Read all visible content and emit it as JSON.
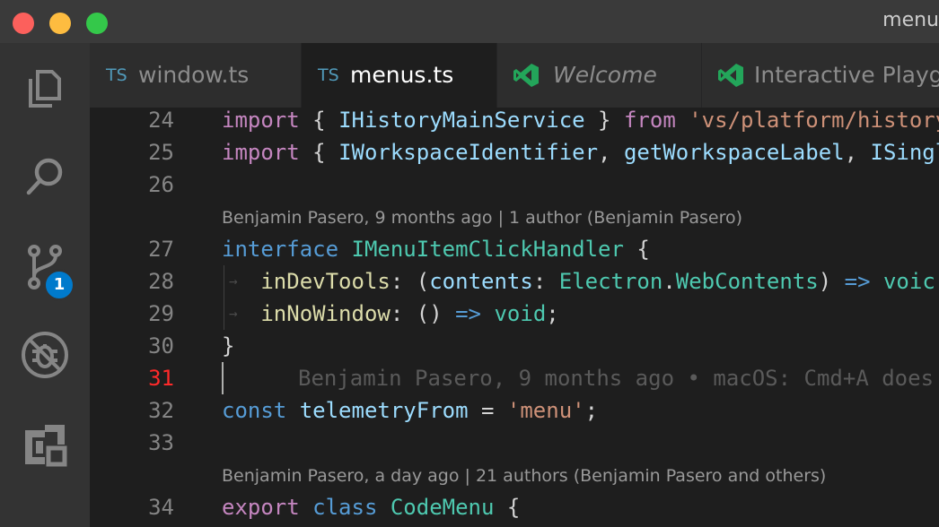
{
  "window": {
    "title": "menu"
  },
  "activity_bar": {
    "items": [
      {
        "name": "explorer",
        "icon": "files-icon"
      },
      {
        "name": "search",
        "icon": "search-icon"
      },
      {
        "name": "source-control",
        "icon": "source-control-icon",
        "badge": "1"
      },
      {
        "name": "debug",
        "icon": "debug-icon"
      },
      {
        "name": "extensions",
        "icon": "extensions-icon"
      }
    ]
  },
  "tabs": [
    {
      "label": "window.ts",
      "icon_text": "TS",
      "active": false
    },
    {
      "label": "menus.ts",
      "icon_text": "TS",
      "active": true
    },
    {
      "label": "Welcome",
      "icon": "vscode-icon",
      "italic": true
    },
    {
      "label": "Interactive Playg",
      "icon": "vscode-icon"
    }
  ],
  "editor": {
    "lines": [
      {
        "num": "24",
        "parts": [
          [
            "kw",
            "import"
          ],
          [
            "p",
            " { "
          ],
          [
            "var",
            "IHistoryMainService"
          ],
          [
            "p",
            " } "
          ],
          [
            "kw",
            "from"
          ],
          [
            "p",
            " "
          ],
          [
            "str",
            "'vs/platform/history"
          ]
        ]
      },
      {
        "num": "25",
        "parts": [
          [
            "kw",
            "import"
          ],
          [
            "p",
            " { "
          ],
          [
            "var",
            "IWorkspaceIdentifier"
          ],
          [
            "p",
            ", "
          ],
          [
            "var",
            "getWorkspaceLabel"
          ],
          [
            "p",
            ", "
          ],
          [
            "var",
            "ISingl"
          ]
        ]
      },
      {
        "num": "26",
        "parts": []
      },
      {
        "num": "27",
        "parts": [
          [
            "kb",
            "interface"
          ],
          [
            "p",
            " "
          ],
          [
            "ty",
            "IMenuItemClickHandler"
          ],
          [
            "p",
            " {"
          ]
        ]
      },
      {
        "num": "28",
        "parts": [
          [
            "p",
            "   "
          ],
          [
            "fn",
            "inDevTools"
          ],
          [
            "p",
            ": ("
          ],
          [
            "var",
            "contents"
          ],
          [
            "p",
            ": "
          ],
          [
            "ty",
            "Electron"
          ],
          [
            "p",
            "."
          ],
          [
            "ty",
            "WebContents"
          ],
          [
            "p",
            ") "
          ],
          [
            "op",
            "=>"
          ],
          [
            "p",
            " "
          ],
          [
            "ty",
            "voic"
          ]
        ]
      },
      {
        "num": "29",
        "parts": [
          [
            "p",
            "   "
          ],
          [
            "fn",
            "inNoWindow"
          ],
          [
            "p",
            ": () "
          ],
          [
            "op",
            "=>"
          ],
          [
            "p",
            " "
          ],
          [
            "ty",
            "void"
          ],
          [
            "p",
            ";"
          ]
        ]
      },
      {
        "num": "30",
        "parts": [
          [
            "p",
            "}"
          ]
        ]
      },
      {
        "num": "31",
        "blame": "Benjamin Pasero, 9 months ago • macOS: Cmd+A does"
      },
      {
        "num": "32",
        "parts": [
          [
            "kb",
            "const"
          ],
          [
            "p",
            " "
          ],
          [
            "var",
            "telemetryFrom"
          ],
          [
            "p",
            " = "
          ],
          [
            "str",
            "'menu'"
          ],
          [
            "p",
            ";"
          ]
        ]
      },
      {
        "num": "33",
        "parts": []
      },
      {
        "num": "34",
        "parts": [
          [
            "kw",
            "export"
          ],
          [
            "p",
            " "
          ],
          [
            "kb",
            "class"
          ],
          [
            "p",
            " "
          ],
          [
            "ty",
            "CodeMenu"
          ],
          [
            "p",
            " {"
          ]
        ]
      }
    ],
    "codelens": [
      "Benjamin Pasero, 9 months ago | 1 author (Benjamin Pasero)",
      "Benjamin Pasero, a day ago | 21 authors (Benjamin Pasero and others)"
    ]
  }
}
